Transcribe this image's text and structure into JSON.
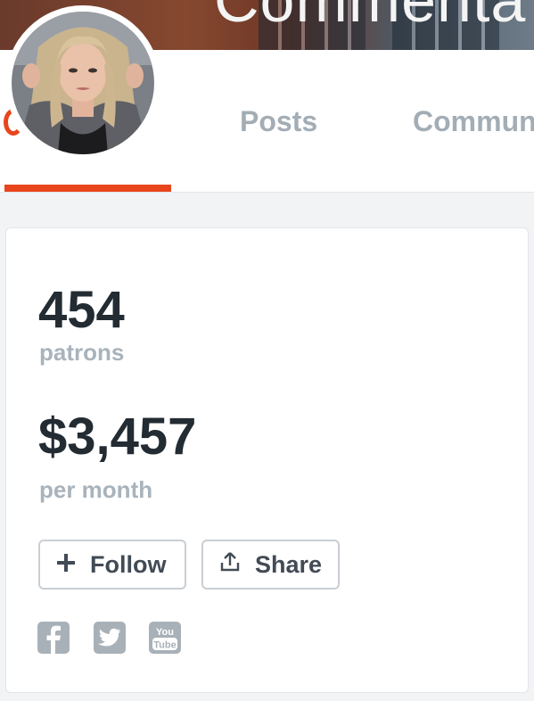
{
  "banner": {
    "title": "Commenta"
  },
  "tabs": {
    "posts_label": "Posts",
    "community_label": "Commun",
    "active_color": "#e8451d"
  },
  "stats": {
    "patrons_value": "454",
    "patrons_label": "patrons",
    "earnings_value": "$3,457",
    "earnings_label": "per month"
  },
  "actions": {
    "follow_label": "Follow",
    "follow_icon": "plus-icon",
    "share_label": "Share",
    "share_icon": "upload-icon"
  },
  "social": {
    "icons": [
      "facebook-icon",
      "twitter-icon",
      "youtube-icon"
    ],
    "youtube_text_top": "You",
    "youtube_text_bottom": "Tube"
  }
}
